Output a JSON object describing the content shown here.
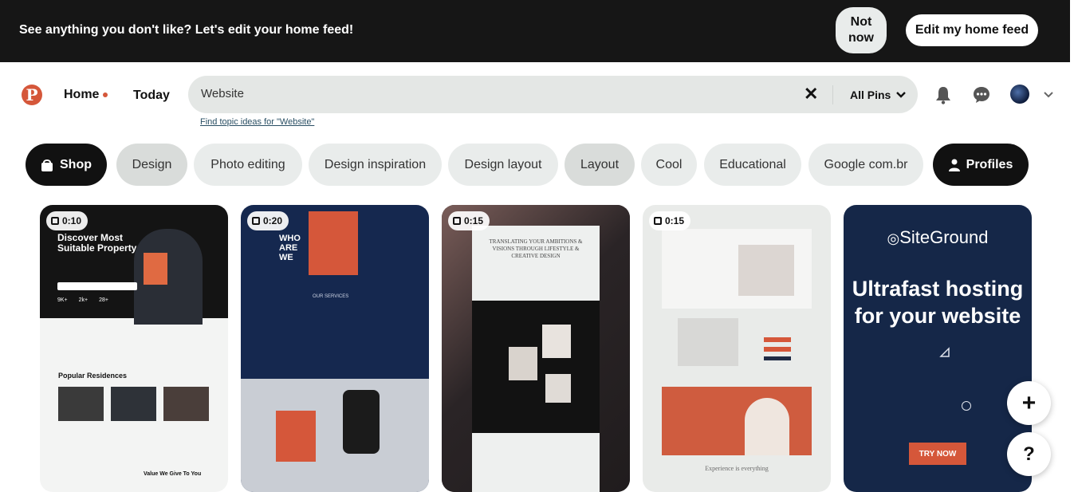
{
  "banner": {
    "message": "See anything you don't like? Let's edit your home feed!",
    "not_now_label": "Not now",
    "edit_label": "Edit my home feed"
  },
  "header": {
    "logo": "P",
    "nav_home": "Home",
    "nav_today": "Today",
    "search_value": "Website",
    "search_scope": "All Pins",
    "topic_link": "Find topic ideas for \"Website\""
  },
  "chips": [
    "Shop",
    "Design",
    "Photo editing",
    "Design inspiration",
    "Design layout",
    "Layout",
    "Cool",
    "Educational",
    "Google com.br",
    "Profiles"
  ],
  "pins": [
    {
      "duration": "0:10",
      "title": "Discover Most Suitable Property",
      "section": "Popular Residences",
      "footer": "Value We Give To You",
      "stats": [
        "9K+",
        "2k+",
        "28+"
      ]
    },
    {
      "duration": "0:20",
      "title": "WHO ARE WE",
      "section": "OUR SERVICES"
    },
    {
      "duration": "0:15",
      "title": "TRANSLATING YOUR AMBITIONS & VISIONS THROUGH LIFESTYLE & CREATIVE DESIGN"
    },
    {
      "duration": "0:15",
      "section": "Experience is everything"
    },
    {
      "brand": "SiteGround",
      "headline": "Ultrafast hosting for your website",
      "cta": "TRY NOW"
    }
  ],
  "colors": {
    "accent": "#d5573a",
    "navy": "#15284f",
    "banner_bg": "#161616"
  },
  "fab": {
    "add": "+",
    "help": "?"
  }
}
